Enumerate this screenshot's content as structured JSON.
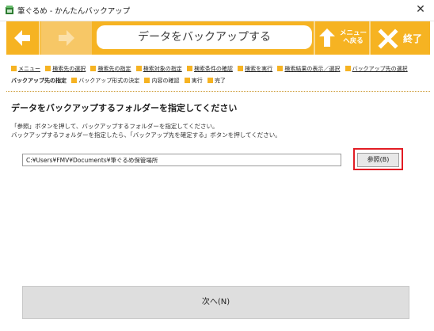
{
  "window": {
    "title": "筆ぐるめ - かんたんバックアップ",
    "close_glyph": "✕"
  },
  "toolbar": {
    "page_title": "データをバックアップする",
    "menu_label_line1": "メニュー",
    "menu_label_line2": "へ戻る",
    "exit_label": "終了",
    "colors": {
      "bar": "#f6b322",
      "arrow_active": "#ffffff",
      "arrow_disabled": "#fbe0a8"
    }
  },
  "breadcrumb": {
    "items": [
      {
        "label": "メニュー",
        "style": "link"
      },
      {
        "label": "検索先の選択",
        "style": "link"
      },
      {
        "label": "検索先の指定",
        "style": "link"
      },
      {
        "label": "検索対象の指定",
        "style": "link"
      },
      {
        "label": "検索条件の確認",
        "style": "link"
      },
      {
        "label": "検索を実行",
        "style": "link"
      },
      {
        "label": "検索結果の表示／選択",
        "style": "link"
      },
      {
        "label": "バックアップ先の選択",
        "style": "link"
      },
      {
        "label": "バックアップ先の指定",
        "style": "current"
      },
      {
        "label": "バックアップ形式の決定",
        "style": "plain"
      },
      {
        "label": "内容の確認",
        "style": "plain"
      },
      {
        "label": "実行",
        "style": "plain"
      },
      {
        "label": "完了",
        "style": "plain"
      }
    ]
  },
  "main": {
    "heading": "データをバックアップするフォルダーを指定してください",
    "description_line1": "「参照」ボタンを押して、バックアップするフォルダーを指定してください。",
    "description_line2": "バックアップするフォルダーを指定したら、「バックアップ先を確定する」ボタンを押してください。",
    "folder_path": "C:¥Users¥FMV¥Documents¥筆ぐるめ保管場所",
    "browse_label": "参照(B)",
    "next_label": "次へ(N)"
  }
}
